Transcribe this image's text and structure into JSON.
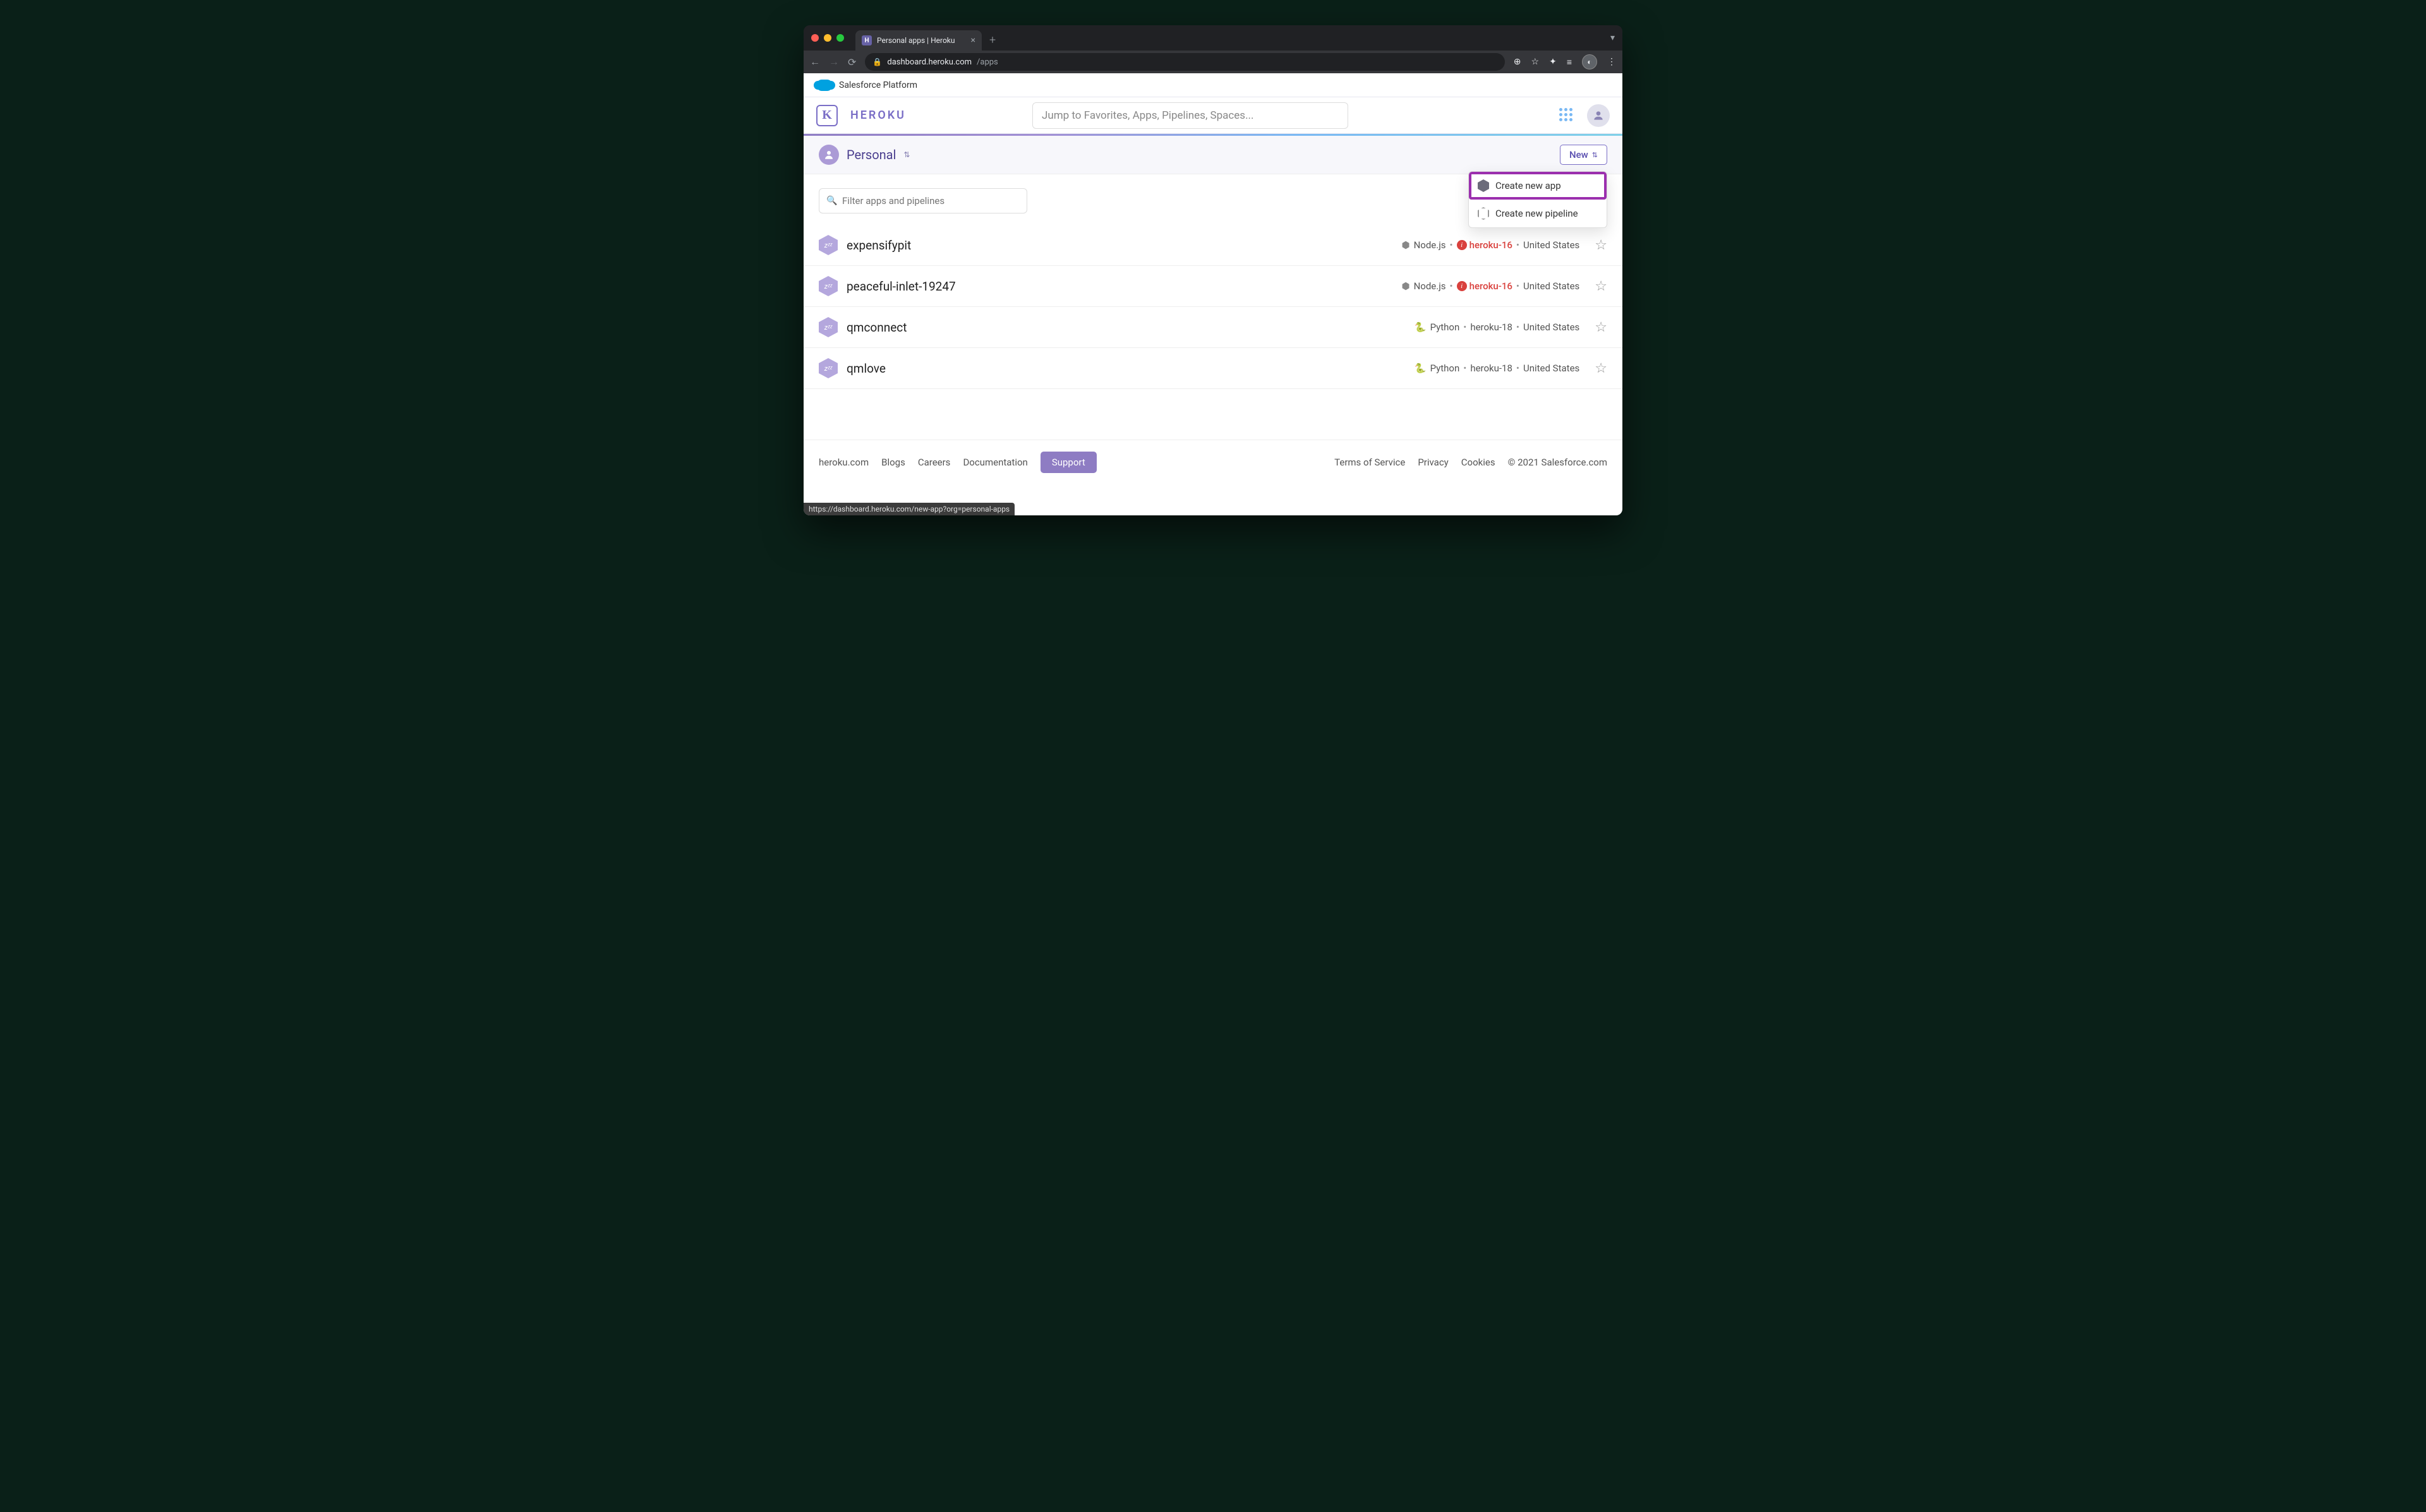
{
  "browser": {
    "tab_title": "Personal apps | Heroku",
    "url_domain": "dashboard.heroku.com",
    "url_path": "/apps",
    "status_url": "https://dashboard.heroku.com/new-app?org=personal-apps"
  },
  "salesforce_bar": {
    "label": "Salesforce Platform"
  },
  "heroku_header": {
    "brand": "HEROKU",
    "search_placeholder": "Jump to Favorites, Apps, Pipelines, Spaces..."
  },
  "context": {
    "scope": "Personal",
    "new_label": "New"
  },
  "dropdown": {
    "create_app": "Create new app",
    "create_pipeline": "Create new pipeline"
  },
  "filter": {
    "placeholder": "Filter apps and pipelines"
  },
  "apps": [
    {
      "name": "expensifypit",
      "lang": "Node.js",
      "stack": "heroku-16",
      "stack_warn": true,
      "region": "United States"
    },
    {
      "name": "peaceful-inlet-19247",
      "lang": "Node.js",
      "stack": "heroku-16",
      "stack_warn": true,
      "region": "United States"
    },
    {
      "name": "qmconnect",
      "lang": "Python",
      "stack": "heroku-18",
      "stack_warn": false,
      "region": "United States"
    },
    {
      "name": "qmlove",
      "lang": "Python",
      "stack": "heroku-18",
      "stack_warn": false,
      "region": "United States"
    }
  ],
  "footer": {
    "links": {
      "heroku": "heroku.com",
      "blogs": "Blogs",
      "careers": "Careers",
      "docs": "Documentation"
    },
    "support": "Support",
    "right": {
      "tos": "Terms of Service",
      "privacy": "Privacy",
      "cookies": "Cookies"
    },
    "copyright": "© 2021 Salesforce.com"
  }
}
